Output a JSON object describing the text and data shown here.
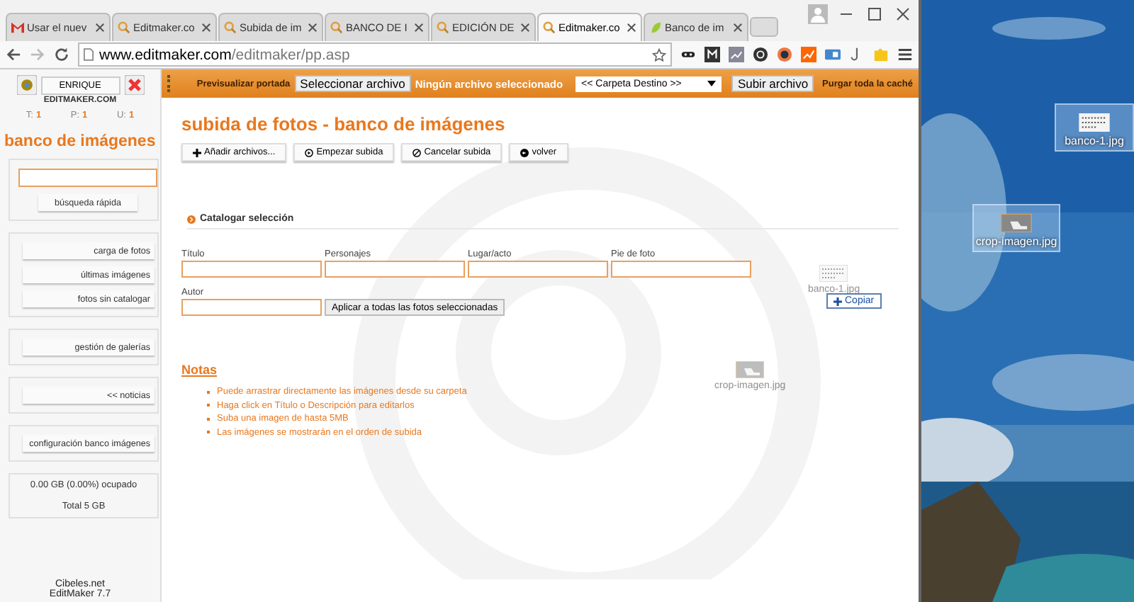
{
  "browser": {
    "tabs": [
      {
        "title": "Usar el nuev",
        "kind": "mail",
        "selected": false
      },
      {
        "title": "Editmaker.co",
        "kind": "site",
        "selected": false
      },
      {
        "title": "Subida de im",
        "kind": "site",
        "selected": false
      },
      {
        "title": "BANCO DE I",
        "kind": "site",
        "selected": false
      },
      {
        "title": "EDICIÓN DE",
        "kind": "site",
        "selected": false
      },
      {
        "title": "Editmaker.co",
        "kind": "site",
        "selected": true
      },
      {
        "title": "Banco de im",
        "kind": "leaf",
        "selected": false
      }
    ],
    "url_host": "www.editmaker.com",
    "url_path": "/editmaker/pp.asp"
  },
  "sidebar": {
    "user": "ENRIQUE",
    "site": "EDITMAKER.COM",
    "counters": [
      {
        "label": "T:",
        "value": "1"
      },
      {
        "label": "P:",
        "value": "1"
      },
      {
        "label": "U:",
        "value": "1"
      }
    ],
    "title": "banco de imágenes",
    "search_button": "búsqueda rápida",
    "groups": [
      [
        "carga de fotos",
        "últimas imágenes",
        "fotos sin catalogar"
      ],
      [
        "gestión de galerías"
      ],
      [
        "<< noticias"
      ],
      [
        "configuración banco imágenes"
      ]
    ],
    "storage_used": "0.00 GB (0.00%) ocupado",
    "storage_total": "Total 5 GB",
    "footer": [
      "Cibeles.net",
      "EditMaker 7.7"
    ]
  },
  "toolbar": {
    "preview": "Previsualizar portada",
    "file_button": "Seleccionar archivo",
    "file_status": "Ningún archivo seleccionado",
    "folder": "<< Carpeta Destino >>",
    "upload": "Subir archivo",
    "purge": "Purgar toda la caché"
  },
  "main": {
    "title": "subida de fotos - banco de imágenes",
    "actions": [
      {
        "label": "Añadir archivos...",
        "kind": "plus"
      },
      {
        "label": "Empezar subida",
        "kind": "start"
      },
      {
        "label": "Cancelar subida",
        "kind": "cancel"
      },
      {
        "label": "volver",
        "kind": "back"
      }
    ],
    "section": "Catalogar selección",
    "fields": [
      {
        "label": "Título"
      },
      {
        "label": "Personajes"
      },
      {
        "label": "Lugar/acto"
      },
      {
        "label": "Pie de foto"
      }
    ],
    "author": {
      "label": "Autor"
    },
    "apply": "Aplicar a todas las fotos seleccionadas",
    "notes_title": "Notas",
    "notes": [
      "Puede arrastrar directamente las imágenes desde su carpeta",
      "Haga click en Título o Descripción para editarlos",
      "Suba una imagen de hasta 5MB",
      "Las imágenes se mostrarán en el orden de subida"
    ],
    "drag": {
      "file1": "banco-1.jpg",
      "copy": "Copiar",
      "file2": "crop-imagen.jpg"
    }
  },
  "desktop": {
    "icons": [
      {
        "name": "banco-1.jpg"
      },
      {
        "name": "crop-imagen.jpg"
      }
    ]
  }
}
